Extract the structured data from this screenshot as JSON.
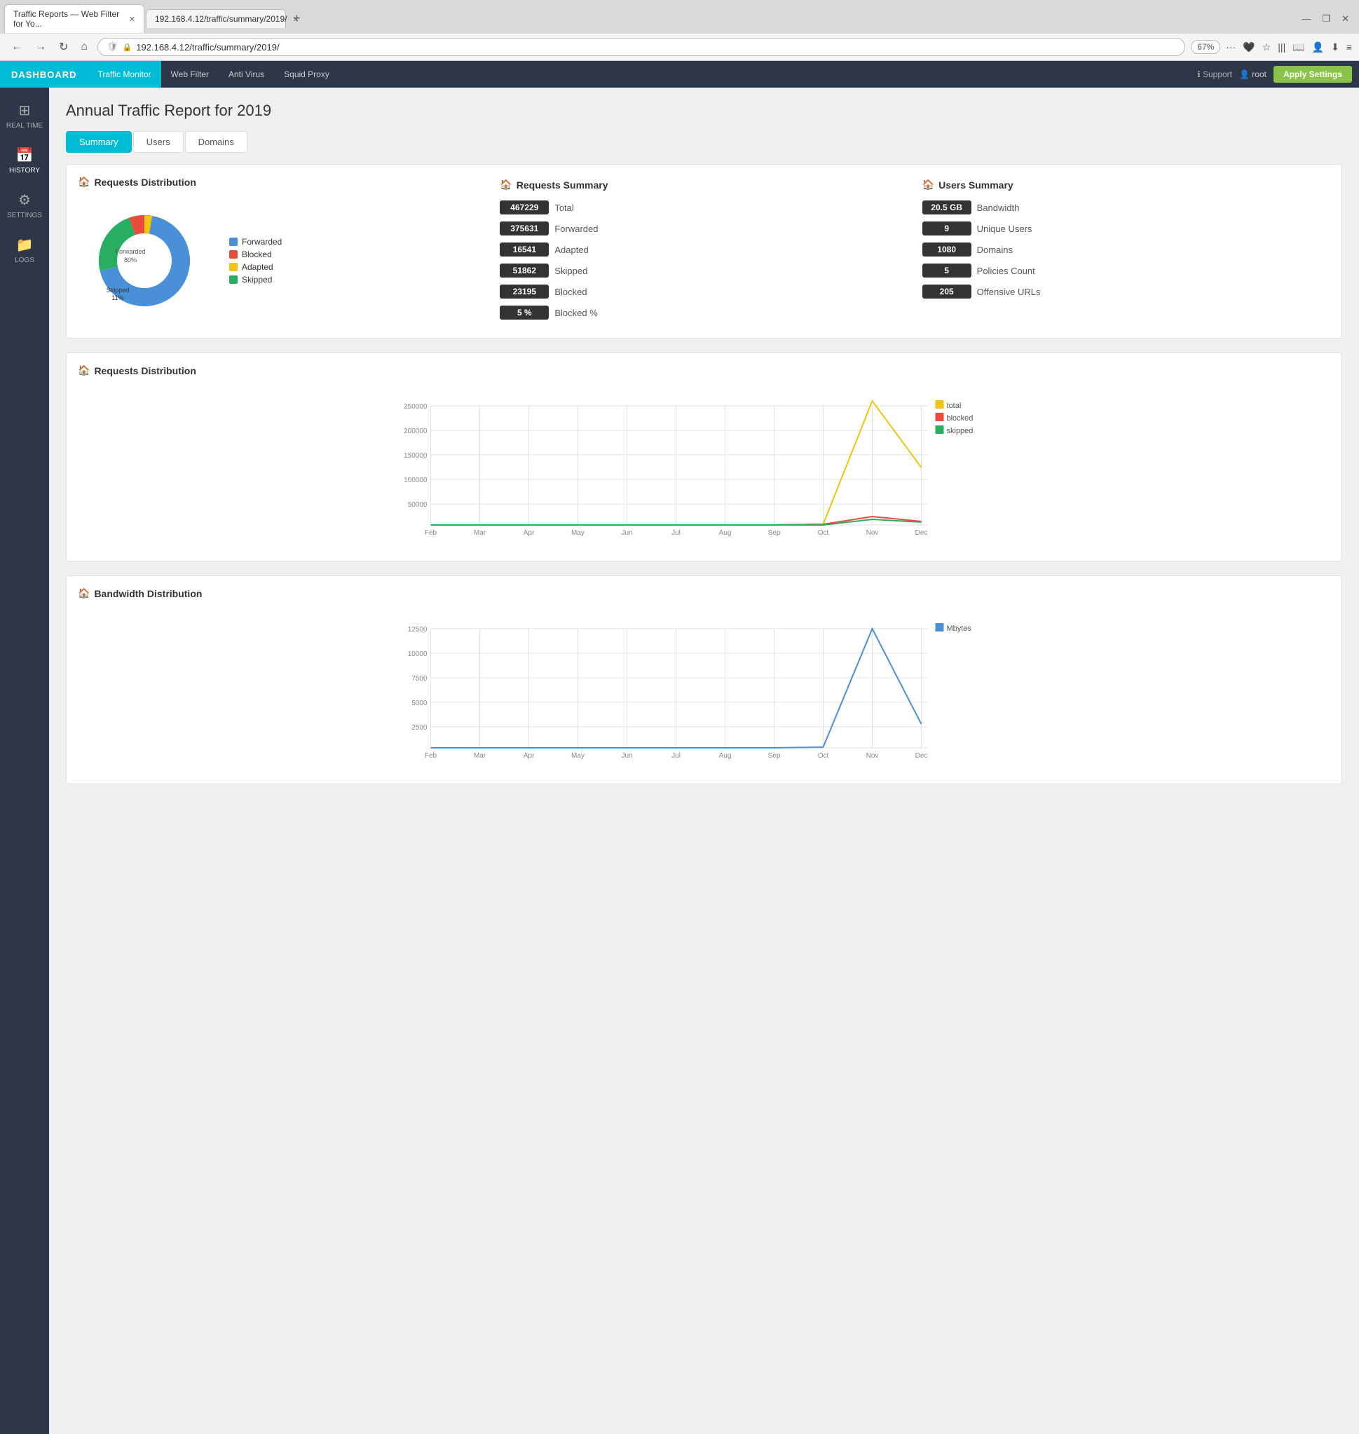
{
  "browser": {
    "tab1": "Traffic Reports — Web Filter for Yo...",
    "tab2": "192.168.4.12/traffic/summary/2019/",
    "url": "192.168.4.12/traffic/summary/2019/",
    "zoom": "67%"
  },
  "appnav": {
    "logo": "DASHBOARD",
    "items": [
      "Traffic Monitor",
      "Web Filter",
      "Anti Virus",
      "Squid Proxy"
    ],
    "active": "Traffic Monitor",
    "support": "Support",
    "user": "root",
    "apply": "Apply Settings"
  },
  "sidebar": {
    "items": [
      {
        "label": "REAL TIME",
        "icon": "⊞"
      },
      {
        "label": "HISTORY",
        "icon": "📅"
      },
      {
        "label": "SETTINGS",
        "icon": "⚙"
      },
      {
        "label": "LOGS",
        "icon": "📁"
      }
    ],
    "active": "HISTORY"
  },
  "page": {
    "title": "Annual Traffic Report for 2019",
    "tabs": [
      "Summary",
      "Users",
      "Domains"
    ],
    "active_tab": "Summary"
  },
  "requests_distribution_section": {
    "title": "Requests Distribution",
    "pie": {
      "segments": [
        {
          "label": "Forwarded",
          "color": "#4a90d9",
          "pct": 80,
          "display": "Forwarded\n80%"
        },
        {
          "label": "Blocked",
          "color": "#e74c3c",
          "pct": 6,
          "display": ""
        },
        {
          "label": "Adapted",
          "color": "#f1c40f",
          "pct": 3,
          "display": ""
        },
        {
          "label": "Skipped",
          "color": "#27ae60",
          "pct": 11,
          "display": "Skipped\n11%"
        }
      ]
    }
  },
  "requests_summary": {
    "title": "Requests Summary",
    "stats": [
      {
        "value": "467229",
        "label": "Total"
      },
      {
        "value": "375631",
        "label": "Forwarded"
      },
      {
        "value": "16541",
        "label": "Adapted"
      },
      {
        "value": "51862",
        "label": "Skipped"
      },
      {
        "value": "23195",
        "label": "Blocked"
      },
      {
        "value": "5 %",
        "label": "Blocked %"
      }
    ]
  },
  "users_summary": {
    "title": "Users Summary",
    "stats": [
      {
        "value": "20.5 GB",
        "label": "Bandwidth"
      },
      {
        "value": "9",
        "label": "Unique Users"
      },
      {
        "value": "1080",
        "label": "Domains"
      },
      {
        "value": "5",
        "label": "Policies Count"
      },
      {
        "value": "205",
        "label": "Offensive URLs"
      }
    ]
  },
  "requests_dist_chart": {
    "title": "Requests Distribution",
    "legend": [
      {
        "label": "total",
        "color": "#f1c40f"
      },
      {
        "label": "blocked",
        "color": "#e74c3c"
      },
      {
        "label": "skipped",
        "color": "#27ae60"
      }
    ],
    "y_labels": [
      "250000",
      "200000",
      "150000",
      "100000",
      "50000"
    ],
    "x_labels": [
      "Feb",
      "Mar",
      "Apr",
      "May",
      "Jun",
      "Jul",
      "Aug",
      "Sep",
      "Oct",
      "Nov",
      "Dec"
    ],
    "series": {
      "total": [
        0,
        0,
        0,
        0,
        0,
        0,
        0,
        0,
        2000,
        260000,
        120000
      ],
      "blocked": [
        0,
        0,
        0,
        0,
        0,
        0,
        0,
        0,
        1000,
        18000,
        8000
      ],
      "skipped": [
        0,
        0,
        0,
        0,
        0,
        0,
        0,
        0,
        500,
        12000,
        6000
      ]
    }
  },
  "bandwidth_chart": {
    "title": "Bandwidth Distribution",
    "legend": [
      {
        "label": "Mbytes",
        "color": "#4a90d9"
      }
    ],
    "y_labels": [
      "12500",
      "10000",
      "7500",
      "5000",
      "2500"
    ],
    "x_labels": [
      "Feb",
      "Mar",
      "Apr",
      "May",
      "Jun",
      "Jul",
      "Aug",
      "Sep",
      "Oct",
      "Nov",
      "Dec"
    ],
    "series": {
      "mbytes": [
        0,
        0,
        0,
        0,
        0,
        0,
        0,
        0,
        100,
        12500,
        2500
      ]
    }
  }
}
